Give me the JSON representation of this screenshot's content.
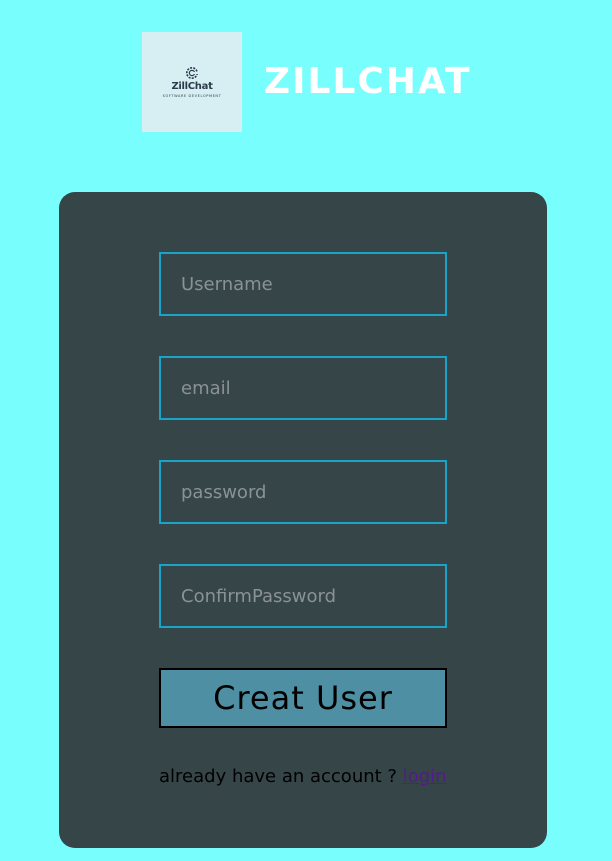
{
  "brand": {
    "logo_name": "ZillChat",
    "logo_tagline": "SOFTWARE DEVELOPMENT",
    "title": "ZILLCHAT"
  },
  "form": {
    "username_placeholder": "Username",
    "email_placeholder": "email",
    "password_placeholder": "password",
    "confirm_placeholder": "ConfirmPassword",
    "submit_label": "Creat User",
    "login_prompt": "already have an account ? ",
    "login_link": "login"
  },
  "colors": {
    "page_background": "#79fefe",
    "card_background": "#354548",
    "input_border": "#1aa3c9",
    "button_background": "#4f8fa3",
    "link": "#551a8b"
  }
}
